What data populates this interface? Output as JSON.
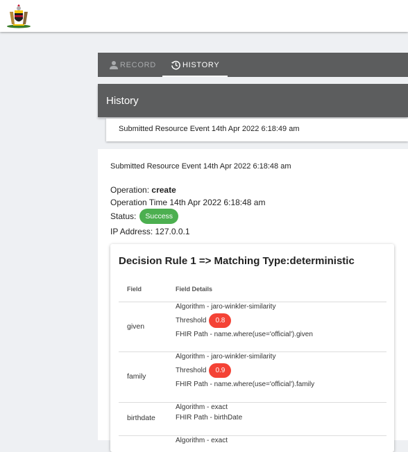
{
  "tabs": {
    "record": "RECORD",
    "history": "HISTORY"
  },
  "history": {
    "title": "History",
    "collapsed_event": "Submitted Resource Event 14th Apr 2022 6:18:49 am",
    "expanded_event": {
      "title": "Submitted Resource Event 14th Apr 2022 6:18:48 am",
      "operation_label": "Operation:",
      "operation_value": "create",
      "operation_time": "Operation Time 14th Apr 2022 6:18:48 am",
      "status_label": "Status:",
      "status_value": "Success",
      "ip_address": "IP Address: 127.0.0.1"
    }
  },
  "rule": {
    "title": "Decision Rule 1 => Matching Type:deterministic",
    "headers": {
      "field": "Field",
      "details": "Field Details"
    },
    "rows": [
      {
        "field": "given",
        "algorithm": "Algorithm - jaro-winkler-similarity",
        "threshold_label": "Threshold",
        "threshold": "0.8",
        "fhir_path": "FHIR Path - name.where(use='official').given"
      },
      {
        "field": "family",
        "algorithm": "Algorithm - jaro-winkler-similarity",
        "threshold_label": "Threshold",
        "threshold": "0.9",
        "fhir_path": "FHIR Path - name.where(use='official').family"
      },
      {
        "field": "birthdate",
        "algorithm": "Algorithm - exact",
        "fhir_path": "FHIR Path - birthDate"
      },
      {
        "algorithm": "Algorithm - exact"
      }
    ]
  },
  "colors": {
    "header_bg": "#5c5d5e",
    "success": "#4caf50",
    "threshold_badge": "#f44336"
  },
  "icons": [
    "coat-of-arms-logo",
    "person-icon",
    "history-icon"
  ]
}
